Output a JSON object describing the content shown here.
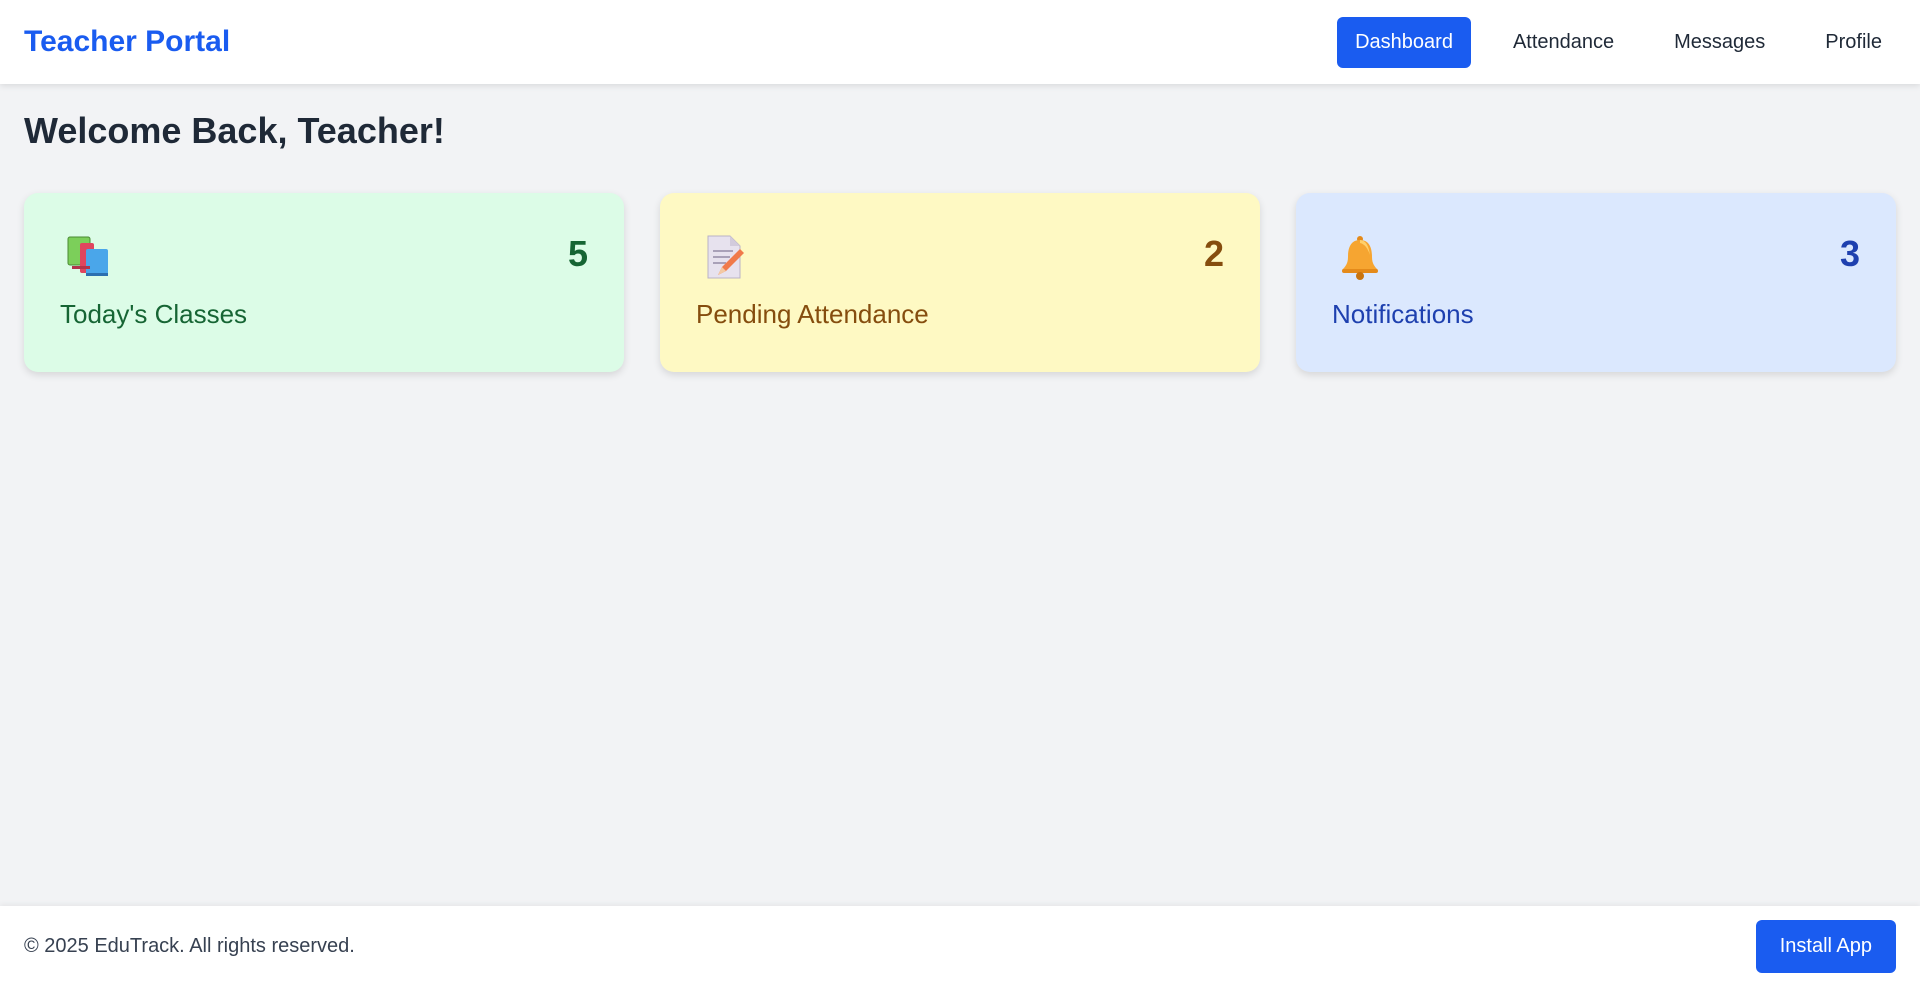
{
  "header": {
    "brand": "Teacher Portal",
    "nav": [
      {
        "label": "Dashboard",
        "active": true
      },
      {
        "label": "Attendance",
        "active": false
      },
      {
        "label": "Messages",
        "active": false
      },
      {
        "label": "Profile",
        "active": false
      }
    ],
    "accent_color": "#1a5cf0"
  },
  "main": {
    "title": "Welcome Back, Teacher!",
    "cards": [
      {
        "icon": "books-icon",
        "count": "5",
        "label": "Today's Classes",
        "color": "#166534",
        "background": "#dcfce7"
      },
      {
        "icon": "memo-icon",
        "count": "2",
        "label": "Pending Attendance",
        "color": "#854d0e",
        "background": "#fef9c3"
      },
      {
        "icon": "bell-icon",
        "count": "3",
        "label": "Notifications",
        "color": "#1e40af",
        "background": "#dbe8fe"
      }
    ]
  },
  "footer": {
    "copyright": "© 2025 EduTrack. All rights reserved.",
    "install_label": "Install App"
  }
}
